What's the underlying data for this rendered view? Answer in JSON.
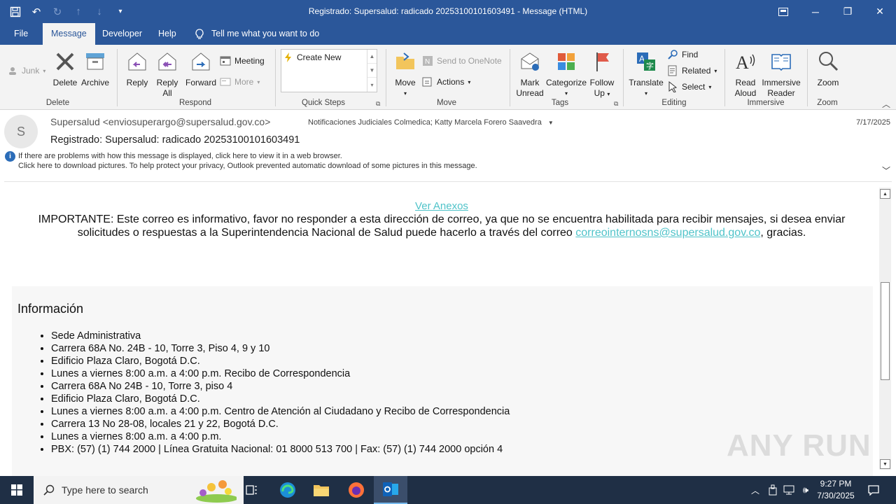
{
  "window": {
    "title": "Registrado: Supersalud: radicado 20253100101603491  -  Message (HTML)"
  },
  "menu": {
    "tabs": [
      "File",
      "Message",
      "Developer",
      "Help"
    ],
    "active_tab": "Message",
    "tell_me": "Tell me what you want to do"
  },
  "ribbon": {
    "delete_group": {
      "label": "Delete",
      "junk": "Junk",
      "delete": "Delete",
      "archive": "Archive"
    },
    "respond_group": {
      "label": "Respond",
      "reply": "Reply",
      "reply_all_1": "Reply",
      "reply_all_2": "All",
      "forward": "Forward",
      "meeting": "Meeting",
      "more": "More"
    },
    "quicksteps_group": {
      "label": "Quick Steps",
      "create_new": "Create New"
    },
    "move_group": {
      "label": "Move",
      "move": "Move",
      "send_onenote": "Send to OneNote",
      "actions": "Actions"
    },
    "tags_group": {
      "label": "Tags",
      "mark_unread_1": "Mark",
      "mark_unread_2": "Unread",
      "categorize": "Categorize",
      "follow_up_1": "Follow",
      "follow_up_2": "Up"
    },
    "editing_group": {
      "label": "Editing",
      "translate": "Translate",
      "find": "Find",
      "related": "Related",
      "select": "Select"
    },
    "immersive_group": {
      "label": "Immersive",
      "read_aloud_1": "Read",
      "read_aloud_2": "Aloud",
      "immersive_reader_1": "Immersive",
      "immersive_reader_2": "Reader"
    },
    "zoom_group": {
      "label": "Zoom",
      "zoom": "Zoom"
    }
  },
  "message": {
    "avatar_initial": "S",
    "sender": "Supersalud <enviosuperargo@supersalud.gov.co>",
    "recipients": "Notificaciones Judiciales Colmedica; Katty Marcela Forero Saavedra",
    "date": "7/17/2025",
    "subject": "Registrado: Supersalud: radicado 20253100101603491",
    "info_line1": "If there are problems with how this message is displayed, click here to view it in a web browser.",
    "info_line2": "Click here to download pictures. To help protect your privacy, Outlook prevented automatic download of some pictures in this message."
  },
  "body": {
    "ver_anexos": "Ver Anexos",
    "importante_text": "IMPORTANTE: Este correo es informativo, favor no responder a esta dirección de correo, ya que no se encuentra habilitada para recibir mensajes, si desea enviar solicitudes o respuestas a la Superintendencia Nacional de Salud puede hacerlo a través del correo ",
    "importante_link": "correointernosns@supersalud.gov.co",
    "importante_tail": ", gracias.",
    "info_title": "Información",
    "info_items": [
      "Sede Administrativa",
      "Carrera 68A No. 24B - 10, Torre 3, Piso 4, 9 y 10",
      "Edificio Plaza Claro, Bogotá D.C.",
      "Lunes a viernes 8:00 a.m. a 4:00 p.m. Recibo de Correspondencia",
      "Carrera 68A No 24B - 10, Torre 3, piso 4",
      "Edificio Plaza Claro, Bogotá D.C.",
      "Lunes a viernes 8:00 a.m. a 4:00 p.m. Centro de Atención al Ciudadano y Recibo de Correspondencia",
      "Carrera 13 No 28-08, locales 21 y 22, Bogotá D.C.",
      "Lunes a viernes 8:00 a.m. a 4:00 p.m.",
      "PBX: (57) (1) 744 2000 | Línea Gratuita Nacional: 01 8000 513 700 | Fax: (57) (1) 744 2000 opción 4"
    ]
  },
  "watermark": "ANY RUN",
  "taskbar": {
    "search_placeholder": "Type here to search",
    "time": "9:27 PM",
    "date": "7/30/2025"
  },
  "colors": {
    "title_bar": "#2b579a",
    "ribbon_bg": "#f3f3f3",
    "link": "#4fc3c9",
    "taskbar": "#1f2f45"
  }
}
